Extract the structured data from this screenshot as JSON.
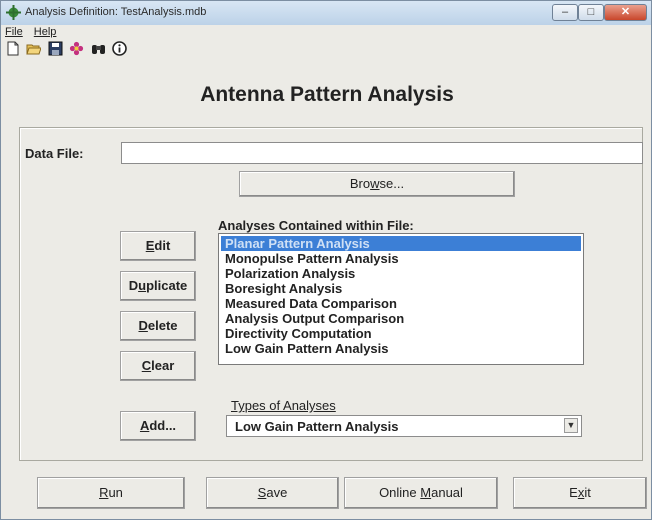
{
  "window": {
    "title": "Analysis Definition: TestAnalysis.mdb",
    "controls": {
      "minimize": "–",
      "maximize": "□",
      "close": "✕"
    }
  },
  "menu": {
    "items": [
      {
        "label": "File"
      },
      {
        "label": "Help"
      }
    ]
  },
  "toolbar": {
    "icons": [
      "new-file-icon",
      "open-folder-icon",
      "save-disk-icon",
      "settings-flower-icon",
      "binoculars-icon",
      "info-icon"
    ]
  },
  "heading": "Antenna Pattern Analysis",
  "datafile": {
    "label": "Data File:",
    "value": ""
  },
  "browse": {
    "pre": "Bro",
    "accel": "w",
    "post": "se..."
  },
  "analyses": {
    "label": "Analyses Contained within File:",
    "items": [
      "Planar Pattern Analysis",
      "Monopulse Pattern Analysis",
      "Polarization Analysis",
      "Boresight Analysis",
      "Measured Data Comparison",
      "Analysis Output Comparison",
      "Directivity Computation",
      "Low Gain Pattern Analysis"
    ],
    "selected_index": 0
  },
  "side_buttons": {
    "edit": {
      "accel": "E",
      "rest": "dit"
    },
    "duplicate": {
      "pre": "D",
      "accel": "u",
      "post": "plicate"
    },
    "delete": {
      "accel": "D",
      "rest": "elete"
    },
    "clear": {
      "accel": "C",
      "rest": "lear"
    },
    "add": {
      "accel": "A",
      "rest": "dd..."
    }
  },
  "types": {
    "label": "Types of Analyses",
    "selected": "Low Gain Pattern Analysis"
  },
  "bottom_buttons": {
    "run": {
      "accel": "R",
      "rest": "un"
    },
    "save": {
      "accel": "S",
      "rest": "ave"
    },
    "manual": {
      "pre": "Online ",
      "accel": "M",
      "post": "anual"
    },
    "exit": {
      "pre": "E",
      "accel": "x",
      "post": "it"
    }
  }
}
